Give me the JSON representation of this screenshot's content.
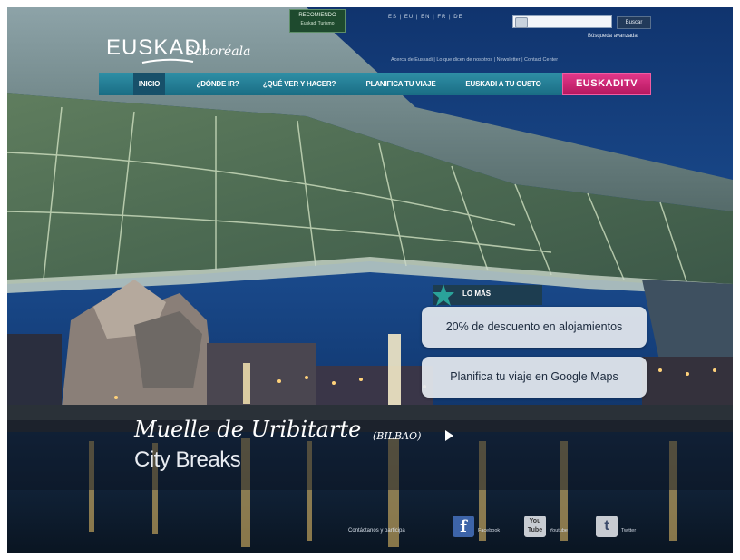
{
  "header": {
    "recommend_title": "RECOMIENDO",
    "recommend_sub": "Euskadi Turismo",
    "languages": "ES | EU | EN | FR | DE",
    "search_placeholder": "",
    "search_button": "Buscar",
    "advanced_search": "Búsqueda avanzada",
    "util_links": "Acerca de Euskadi | Lo que dicen de nosotros | Newsletter | Contact Center"
  },
  "logo": {
    "main": "EUSKADI",
    "tagline": "Saboréala"
  },
  "nav": {
    "items": [
      "INICIO",
      "¿DÓNDE IR?",
      "¿QUÉ VER Y HACER?",
      "PLANIFICA TU VIAJE",
      "EUSKADI A TU GUSTO"
    ],
    "tv": "EUSKADITV"
  },
  "lo_mas": {
    "label": "LO MÁS",
    "items": [
      "20% de descuento en alojamientos",
      "Planifica tu viaje en Google Maps"
    ]
  },
  "caption": {
    "title": "Muelle de Uribitarte",
    "place": "(BILBAO)",
    "subtitle": "City Breaks"
  },
  "footer": {
    "contact": "Contáctanos y participa",
    "facebook": "Facebook",
    "youtube": "Youtube",
    "twitter": "Twitter",
    "youtube_icon": "You Tube"
  },
  "colors": {
    "nav": "#1f7d94",
    "tv": "#d12a7a",
    "accent_teal": "#2aa39a"
  }
}
